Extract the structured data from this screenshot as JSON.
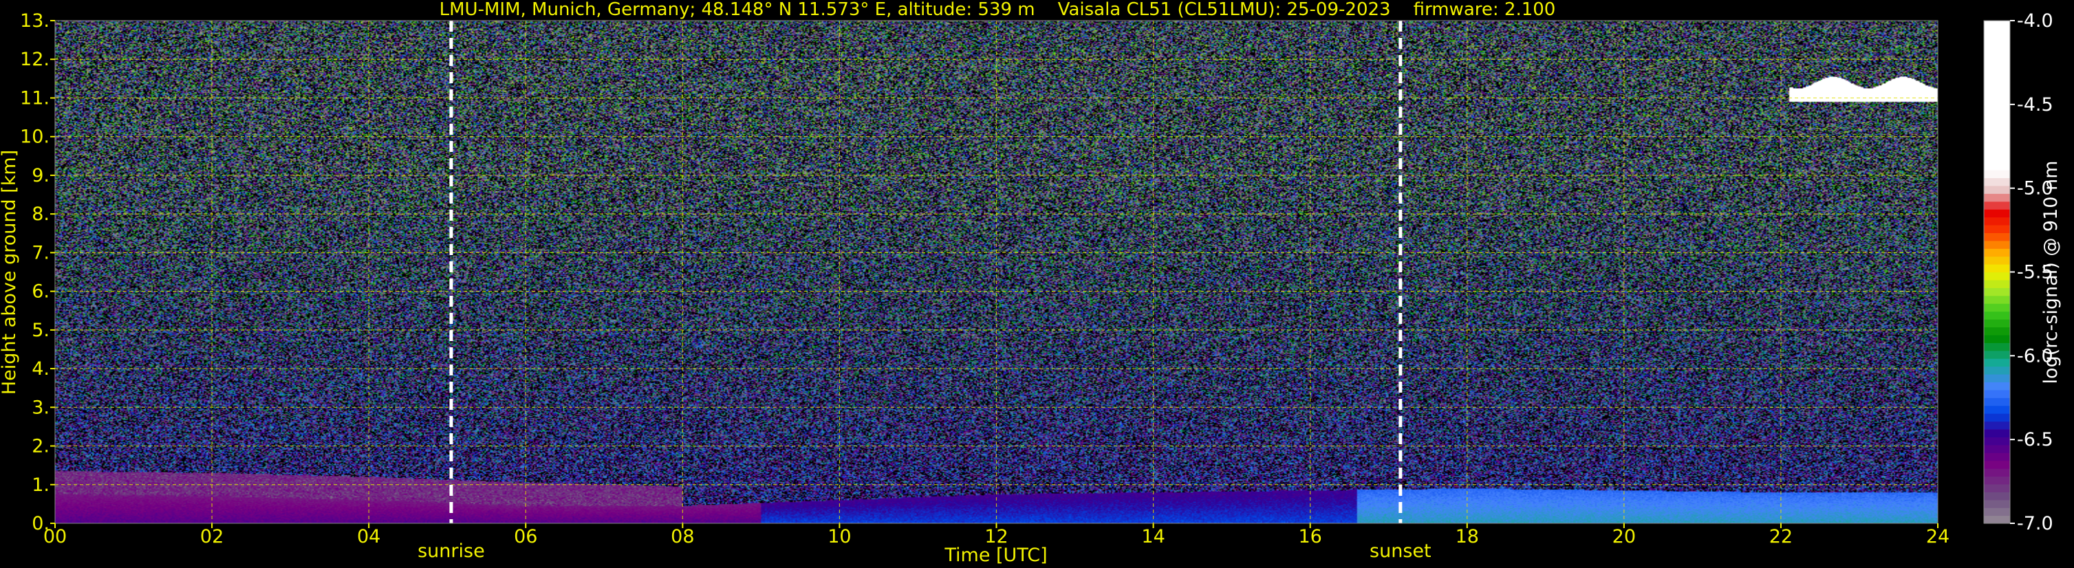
{
  "chart_data": {
    "type": "heatmap",
    "title": "LMU-MIM, Munich, Germany; 48.148° N 11.573° E, altitude: 539 m    Vaisala CL51 (CL51LMU): 25-09-2023    firmware: 2.100",
    "xlabel": "Time [UTC]",
    "ylabel": "Height above ground [km]",
    "colorbar_label": "log(rc-signal) @ 910 nm",
    "xlim": [
      0,
      24
    ],
    "ylim": [
      0,
      13
    ],
    "clim": [
      -7.0,
      -4.0
    ],
    "grid": true,
    "x_ticks": [
      "00",
      "02",
      "04",
      "06",
      "08",
      "10",
      "12",
      "14",
      "16",
      "18",
      "20",
      "22",
      "24"
    ],
    "y_ticks": [
      "0.",
      "1.",
      "2.",
      "3.",
      "4.",
      "5.",
      "6.",
      "7.",
      "8.",
      "9.",
      "10.",
      "11.",
      "12.",
      "13."
    ],
    "colorbar_ticks": [
      "-4.0",
      "-4.5",
      "-5.0",
      "-5.5",
      "-6.0",
      "-6.5",
      "-7.0"
    ],
    "events": [
      {
        "label": "sunrise",
        "time": 5.05
      },
      {
        "label": "sunset",
        "time": 17.15
      }
    ],
    "features": [
      {
        "kind": "boundary-layer-top",
        "times": [
          0,
          2,
          4,
          6,
          8,
          10,
          12,
          14,
          16,
          18,
          20,
          22,
          24
        ],
        "heights": [
          0.75,
          0.7,
          0.6,
          0.45,
          0.45,
          0.6,
          0.75,
          0.8,
          0.85,
          0.9,
          0.85,
          0.8,
          0.8
        ]
      },
      {
        "kind": "residual-layer-top",
        "times": [
          0,
          2,
          4,
          6,
          8
        ],
        "heights": [
          1.35,
          1.3,
          1.2,
          1.05,
          0.95
        ]
      },
      {
        "kind": "cirrus-cloud",
        "time_range": [
          22.1,
          24.0
        ],
        "height_range": [
          10.9,
          11.4
        ]
      }
    ]
  }
}
